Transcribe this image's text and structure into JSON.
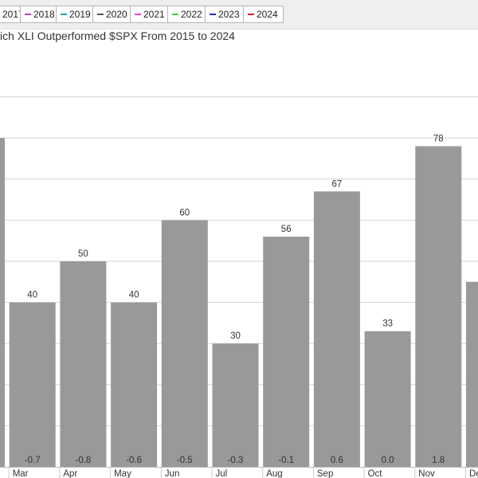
{
  "legend": {
    "items": [
      {
        "label": "2017",
        "color": "#888888"
      },
      {
        "label": "2018",
        "color": "#b03fd6"
      },
      {
        "label": "2019",
        "color": "#1fa6a6"
      },
      {
        "label": "2020",
        "color": "#555555"
      },
      {
        "label": "2021",
        "color": "#ee3fe0"
      },
      {
        "label": "2022",
        "color": "#3fd23f"
      },
      {
        "label": "2023",
        "color": "#2a2acc"
      },
      {
        "label": "2024",
        "color": "#e02020"
      }
    ]
  },
  "chart": {
    "title": "ich XLI Outperformed $SPX From 2015 to 2024"
  },
  "chart_data": {
    "type": "bar",
    "title": "ich XLI Outperformed $SPX From 2015 to 2024",
    "categories": [
      "",
      "Mar",
      "Apr",
      "May",
      "Jun",
      "Jul",
      "Aug",
      "Sep",
      "Oct",
      "Nov",
      "De"
    ],
    "values": [
      80,
      40,
      50,
      40,
      60,
      30,
      56,
      67,
      33,
      78,
      45
    ],
    "value_labels": [
      "",
      "40",
      "50",
      "40",
      "60",
      "30",
      "56",
      "67",
      "33",
      "78",
      ""
    ],
    "secondary_values": [
      null,
      -0.7,
      -0.8,
      -0.6,
      -0.5,
      -0.3,
      -0.1,
      0.6,
      0.0,
      1.8,
      null
    ],
    "secondary_labels": [
      "",
      "-0.7",
      "-0.8",
      "-0.6",
      "-0.5",
      "-0.3",
      "-0.1",
      "0.6",
      "0.0",
      "1.8",
      ""
    ],
    "ylim": [
      0,
      90
    ],
    "grid": true,
    "bar_color": "#999999"
  }
}
